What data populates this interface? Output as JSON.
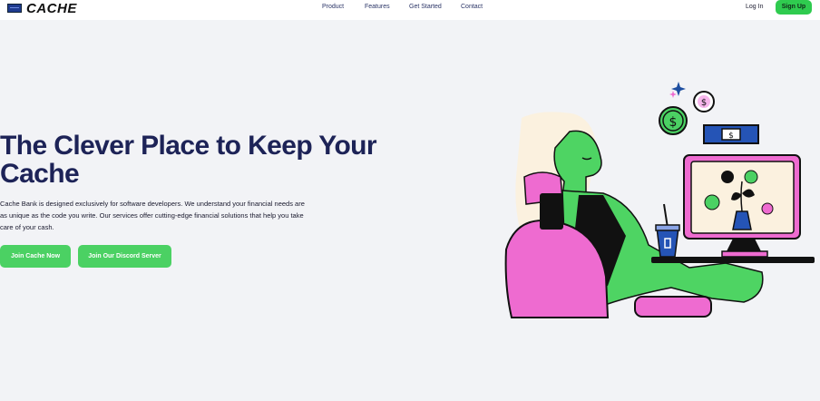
{
  "header": {
    "brand": "CACHE",
    "nav": [
      "Product",
      "Features",
      "Get Started",
      "Contact"
    ],
    "login_label": "Log In",
    "signup_label": "Sign Up"
  },
  "hero": {
    "title": "The Clever Place to Keep Your Cache",
    "description": "Cache Bank is designed exclusively for software developers. We understand your financial needs are as unique as the code you write. Our services offer cutting-edge financial solutions that help you take care of your cash.",
    "primary_cta": "Join Cache Now",
    "secondary_cta": "Join Our Discord Server"
  },
  "colors": {
    "background": "#f2f3f6",
    "headline": "#1d2357",
    "accent_green": "#4bd163",
    "accent_pink": "#ee6bd0"
  },
  "illustration": {
    "icons": [
      "dollar-coin-icon",
      "banknote-icon",
      "sparkle-icon",
      "monitor-icon",
      "plant-icon",
      "coffee-cup-icon"
    ]
  }
}
